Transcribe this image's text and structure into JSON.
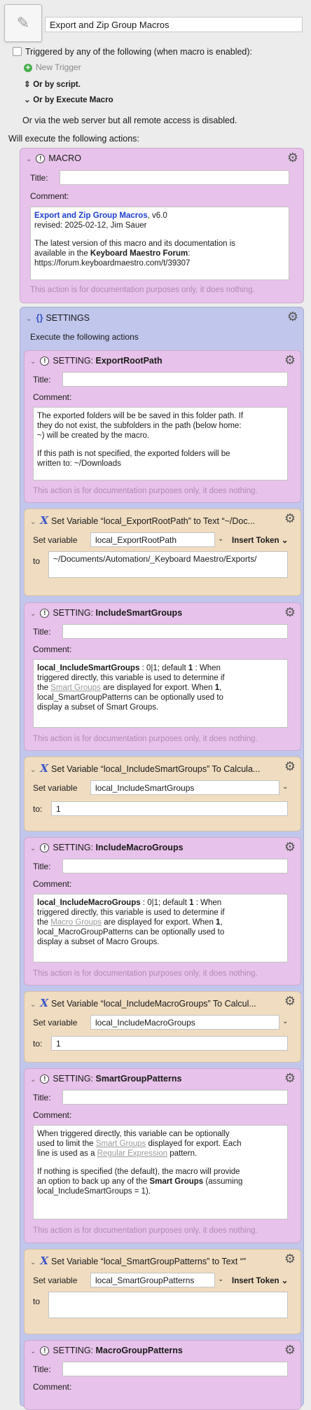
{
  "macro": {
    "name": "Export and Zip Group Macros"
  },
  "triggers": {
    "checkbox_label": "Triggered by any of the following (when macro is enabled):",
    "new_trigger": "New Trigger",
    "by_script": "Or by script.",
    "by_execute_macro": "Or by Execute Macro",
    "web_server": "Or via the web server but all remote access is disabled."
  },
  "will_execute": "Will execute the following actions:",
  "common": {
    "title_label": "Title:",
    "comment_label": "Comment:",
    "doc_note": "This action is for documentation purposes only, it does nothing.",
    "set_variable_label": "Set variable",
    "to_label": "to",
    "to_colon_label": "to:",
    "insert_token": "Insert Token"
  },
  "block_macro": {
    "title": "MACRO",
    "comment": {
      "link": "Export and Zip Group Macros",
      "version": ", v6.0",
      "revised": "revised: 2025-02-12, Jim Sauer",
      "line1": "The latest version of this macro and its documentation is",
      "line2a": "available in the ",
      "line2b": "Keyboard Maestro Forum",
      "line2c": ":",
      "url": "https://forum.keyboardmaestro.com/t/39307"
    }
  },
  "block_settings": {
    "title": "SETTINGS",
    "subtitle": "Execute the following actions"
  },
  "block_export_root": {
    "title_prefix": "SETTING: ",
    "title_name": "ExportRootPath",
    "comment": {
      "l1": "The exported folders will be be saved in this folder path. If",
      "l2": "they do not exist, the subfolders in the path (below home:",
      "l3": "~) will be created by the macro.",
      "l4": "If this path is not specified, the exported folders will be",
      "l5": "written to: ~/Downloads"
    }
  },
  "block_set_root": {
    "title": "Set Variable “local_ExportRootPath” to Text “~/Doc...",
    "variable": "local_ExportRootPath",
    "value": "~/Documents/Automation/_Keyboard Maestro/Exports/"
  },
  "block_include_smart": {
    "title_prefix": "SETTING: ",
    "title_name": "IncludeSmartGroups",
    "comment": {
      "var": "local_IncludeSmartGroups",
      "l1a": " : 0|1; default ",
      "l1b": "1",
      "l1c": " : When",
      "l2": "triggered directly, this variable is used to determine if",
      "l3a": "the ",
      "l3link": "Smart Groups",
      "l3b": " are displayed for export. When ",
      "l3c": "1",
      "l3d": ",",
      "l4": "local_SmartGroupPatterns can be optionally used to",
      "l5": "display a subset of Smart Groups."
    }
  },
  "block_set_smart": {
    "title": "Set Variable “local_IncludeSmartGroups” To Calcula...",
    "variable": "local_IncludeSmartGroups",
    "value": "1"
  },
  "block_include_macro": {
    "title_prefix": "SETTING: ",
    "title_name": "IncludeMacroGroups",
    "comment": {
      "var": "local_IncludeMacroGroups",
      "l1a": " : 0|1; default ",
      "l1b": "1",
      "l1c": " : When",
      "l2": "triggered directly, this variable is used to determine if",
      "l3a": "the ",
      "l3link": "Macro Groups",
      "l3b": " are displayed for export. When ",
      "l3c": "1",
      "l3d": ",",
      "l4": "local_MacroGroupPatterns can be optionally used to",
      "l5": "display a subset of Macro Groups."
    }
  },
  "block_set_macro": {
    "title": "Set Variable “local_IncludeMacroGroups” To Calcul...",
    "variable": "local_IncludeMacroGroups",
    "value": "1"
  },
  "block_smart_patterns": {
    "title_prefix": "SETTING: ",
    "title_name": "SmartGroupPatterns",
    "comment": {
      "l1": "When triggered directly, this variable can be optionally",
      "l2a": "used to limit the ",
      "l2link": "Smart Groups",
      "l2b": " displayed for export. Each",
      "l3a": "line is used as a ",
      "l3link": "Regular Expression",
      "l3b": " pattern.",
      "l4": "If nothing is specified (the default), the macro will provide",
      "l5a": "an option to back up any of the ",
      "l5b": "Smart Groups",
      "l5c": " (assuming",
      "l6": "local_IncludeSmartGroups = 1)."
    }
  },
  "block_set_smart_patterns": {
    "title": "Set Variable “local_SmartGroupPatterns” to Text “”",
    "variable": "local_SmartGroupPatterns",
    "value": ""
  },
  "block_macro_patterns": {
    "title_prefix": "SETTING: ",
    "title_name": "MacroGroupPatterns"
  }
}
